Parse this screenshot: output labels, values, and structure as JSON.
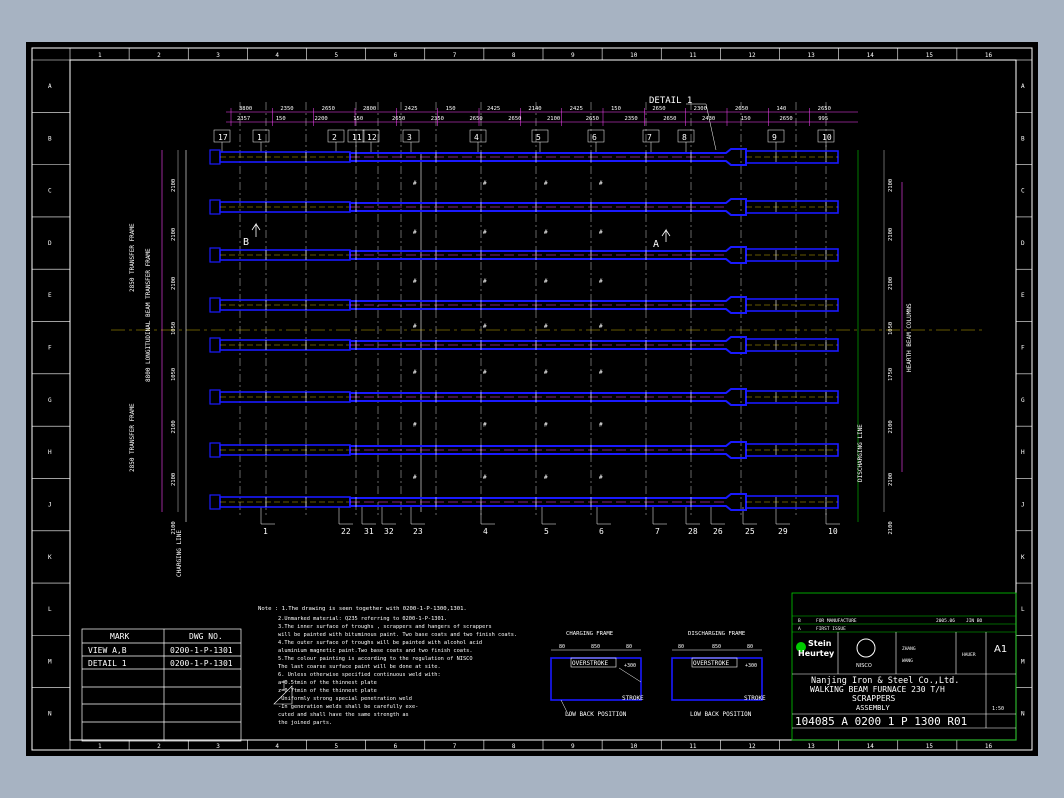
{
  "colors": {
    "background": "#a7b3c2",
    "sheet": "#000000",
    "beam": "#1a1aff",
    "dim": "#ff44ff",
    "green": "#00cc00",
    "white": "#ffffff",
    "yellow": "#ffdd00"
  },
  "detail_label": "DETAIL 1",
  "section_marks": {
    "a": "A",
    "b": "B"
  },
  "top_dims": [
    "2357",
    "150",
    "2200",
    "150",
    "2650",
    "2350",
    "2650",
    "2650",
    "2100",
    "2650",
    "2350",
    "2650",
    "2430",
    "150",
    "2650",
    "995"
  ],
  "top_dims2": [
    "3800",
    "2350",
    "2650",
    "2800",
    "2425",
    "150",
    "2425",
    "2140",
    "2425",
    "150",
    "2650",
    "2300",
    "2650",
    "140",
    "2650"
  ],
  "top_marks": [
    "17",
    "1",
    "2",
    "11",
    "12",
    "3",
    "4",
    "5",
    "6",
    "7",
    "8",
    "9",
    "10"
  ],
  "bottom_marks": [
    "1",
    "22",
    "31",
    "32",
    "23",
    "4",
    "5",
    "6",
    "7",
    "28",
    "26",
    "25",
    "29",
    "10"
  ],
  "left_labels": {
    "transfer_top": "2850 TRANSFER FRAME",
    "longitudinal": "8800 LONGITUDINAL BEAM TRANSFER FRAME",
    "transfer_bottom": "2850 TRANSFER FRAME",
    "charging": "CHARGING LINE"
  },
  "right_labels": {
    "hearth": "HEARTH BEAM COLUMNS",
    "discharging": "DISCHARGING LINE"
  },
  "row_dims_left": [
    "2100",
    "2100",
    "2100",
    "1050",
    "1050",
    "2100",
    "2100",
    "2100"
  ],
  "row_dims_right": [
    "2100",
    "2100",
    "2100",
    "1050",
    "1750",
    "2100",
    "2100",
    "2100"
  ],
  "notes": {
    "header": "Note : 1.The drawing is seen together with 0200-1-P-1300,1301.",
    "lines": [
      "2.Unmarked material: Q235 referring to 0200-1-P-1301.",
      "3.The inner surface of troughs , scrappers and hangers of scrappers",
      "  will be painted with bituminous paint. Two base coats and two finish coats.",
      "4.The outer surface of troughs will be painted with alcohol acid",
      "  aluminium magnetic paint.Two base coats and two finish coats.",
      "5.The colour painting is according to the regulation of NISCO",
      "  The last coarse surface paint will be done at site.",
      "6. Unless otherwise specified continuous weld with:",
      "   a=0.5tmin of the thinnest plate",
      "   z=0.7tmin of the thinnest plate",
      "-Uniformly strong special penetration weld",
      "-In generation welds shall be carefully exe-",
      "  cuted and shall have the same strength as",
      "  the joined parts."
    ]
  },
  "ref_table": {
    "headers": [
      "MARK",
      "DWG NO."
    ],
    "rows": [
      [
        "VIEW A,B",
        "0200-1-P-1301"
      ],
      [
        "DETAIL 1",
        "0200-1-P-1301"
      ],
      [
        "",
        ""
      ],
      [
        "",
        ""
      ],
      [
        "",
        ""
      ]
    ]
  },
  "frames": {
    "charging": {
      "title": "CHARGING FRAME",
      "over": "OVERSTROKE",
      "stroke": "STROKE",
      "low": "LOW BACK POSITION",
      "dims": [
        "80",
        "850",
        "80"
      ],
      "up": "+300"
    },
    "discharging": {
      "title": "DISCHARGING FRAME",
      "over": "OVERSTROKE",
      "stroke": "STROKE",
      "low": "LOW BACK POSITION",
      "dims": [
        "80",
        "850",
        "80"
      ],
      "up": "+300"
    }
  },
  "title_block": {
    "rev_rows": [
      [
        "B",
        "FOR MANUFACTURE",
        "2005.06",
        "JIN BO"
      ],
      [
        "A",
        "FIRST ISSUE",
        "",
        ""
      ]
    ],
    "company1": "Stein",
    "company2": "Heurtey",
    "client_logo": "NISCO",
    "client": "Nanjing Iron & Steel  Co.,Ltd.",
    "project": "WALKING BEAM FURNACE 230 T/H",
    "title": "SCRAPPERS",
    "subtitle": "ASSEMBLY",
    "drawing_no": "104085  A 0200 1 P 1300  R01",
    "size": "A1",
    "scale": "1:50",
    "names": [
      "ZHANG",
      "WANG",
      "HAUER"
    ]
  },
  "border_letters": [
    "A",
    "B",
    "C",
    "D",
    "E",
    "F",
    "G",
    "H",
    "J",
    "K",
    "L",
    "M",
    "N"
  ],
  "border_numbers": [
    "1",
    "2",
    "3",
    "4",
    "5",
    "6",
    "7",
    "8",
    "9",
    "10",
    "11",
    "12",
    "13",
    "14",
    "15",
    "16"
  ]
}
